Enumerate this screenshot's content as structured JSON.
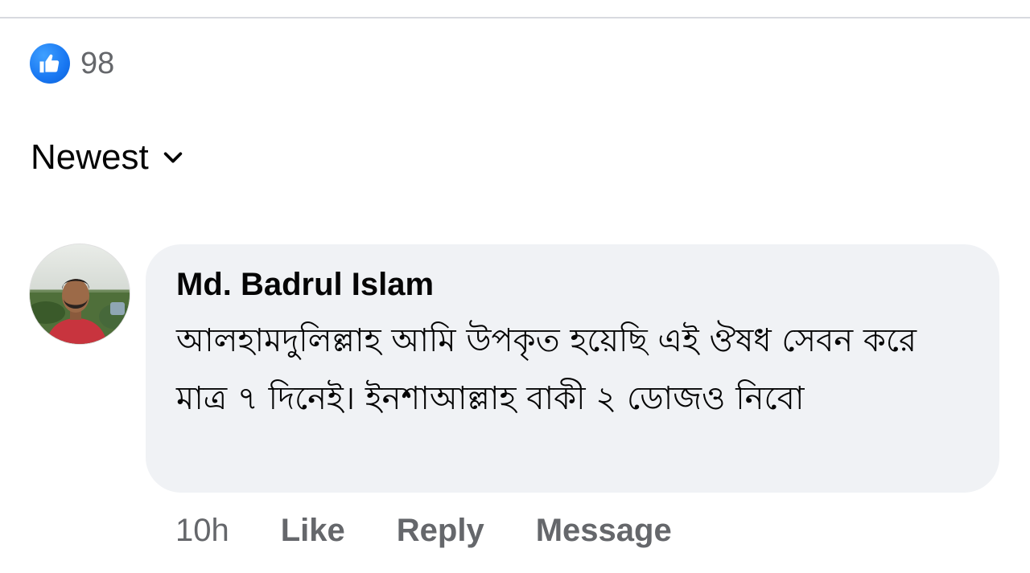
{
  "reactions": {
    "icon": "like-icon",
    "count": "98",
    "color": "#1877f2"
  },
  "sort": {
    "label": "Newest",
    "icon": "chevron-down-icon"
  },
  "comment": {
    "author": "Md. Badrul Islam",
    "text": "আলহামদুলিল্লাহ আমি উপকৃত হয়েছি এই ঔষধ সেবন করে মাত্র ৭ দিনেই। ইনশাআল্লাহ বাকী ২ ডোজও নিবো",
    "time": "10h",
    "actions": {
      "like": "Like",
      "reply": "Reply",
      "message": "Message"
    },
    "bubble_color": "#f0f2f5"
  }
}
